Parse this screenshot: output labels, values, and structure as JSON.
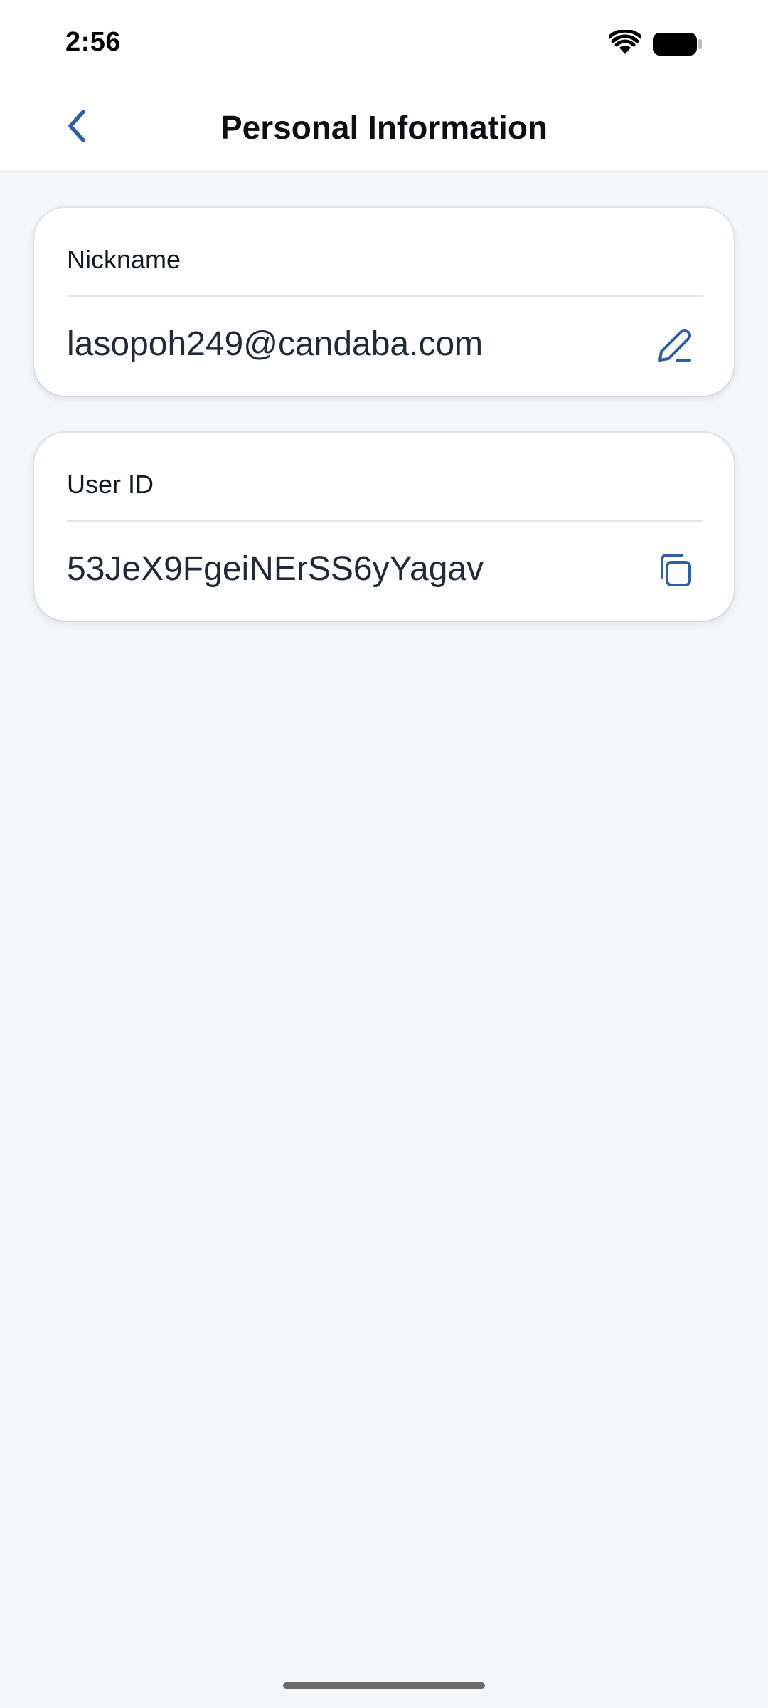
{
  "status_bar": {
    "time": "2:56",
    "icons": [
      "wifi-icon",
      "battery-icon"
    ]
  },
  "header": {
    "title": "Personal Information",
    "back_icon": "chevron-left-icon"
  },
  "fields": [
    {
      "label": "Nickname",
      "value": "lasopoh249@candaba.com",
      "action_icon": "edit-pencil-icon"
    },
    {
      "label": "User ID",
      "value": "53JeX9FgeiNErSS6yYagav",
      "action_icon": "copy-icon"
    }
  ],
  "colors": {
    "accent": "#2f5ea8",
    "background": "#f6f7f9",
    "card": "#ffffff",
    "title_text": "#0d0f12",
    "value_text": "#222a3a"
  }
}
